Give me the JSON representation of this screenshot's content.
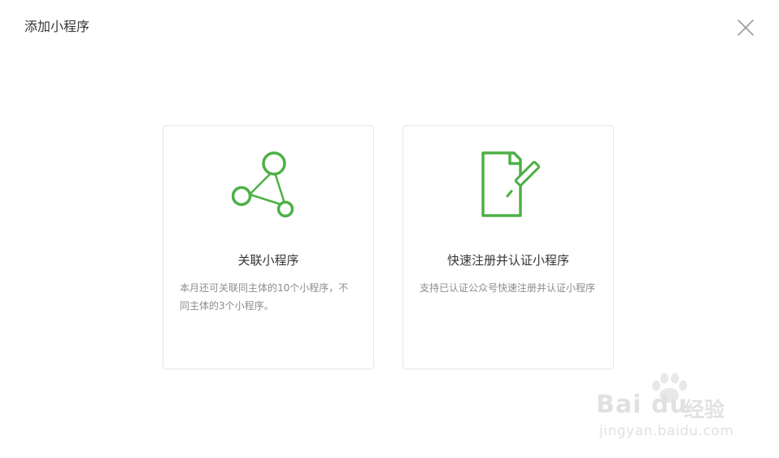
{
  "dialog": {
    "title": "添加小程序"
  },
  "icons": {
    "close": "close-icon",
    "link": "share-nodes-icon",
    "register": "document-pen-icon"
  },
  "colors": {
    "accent": "#4eb046",
    "close": "#9b9b9b"
  },
  "cards": {
    "link": {
      "title": "关联小程序",
      "description": "本月还可关联同主体的10个小程序，不同主体的3个小程序。"
    },
    "register": {
      "title": "快速注册并认证小程序",
      "description": "支持已认证公众号快速注册并认证小程序"
    }
  },
  "watermark": {
    "brand": "Bai du",
    "brand_cn": "经验",
    "url": "jingyan.baidu.com"
  }
}
